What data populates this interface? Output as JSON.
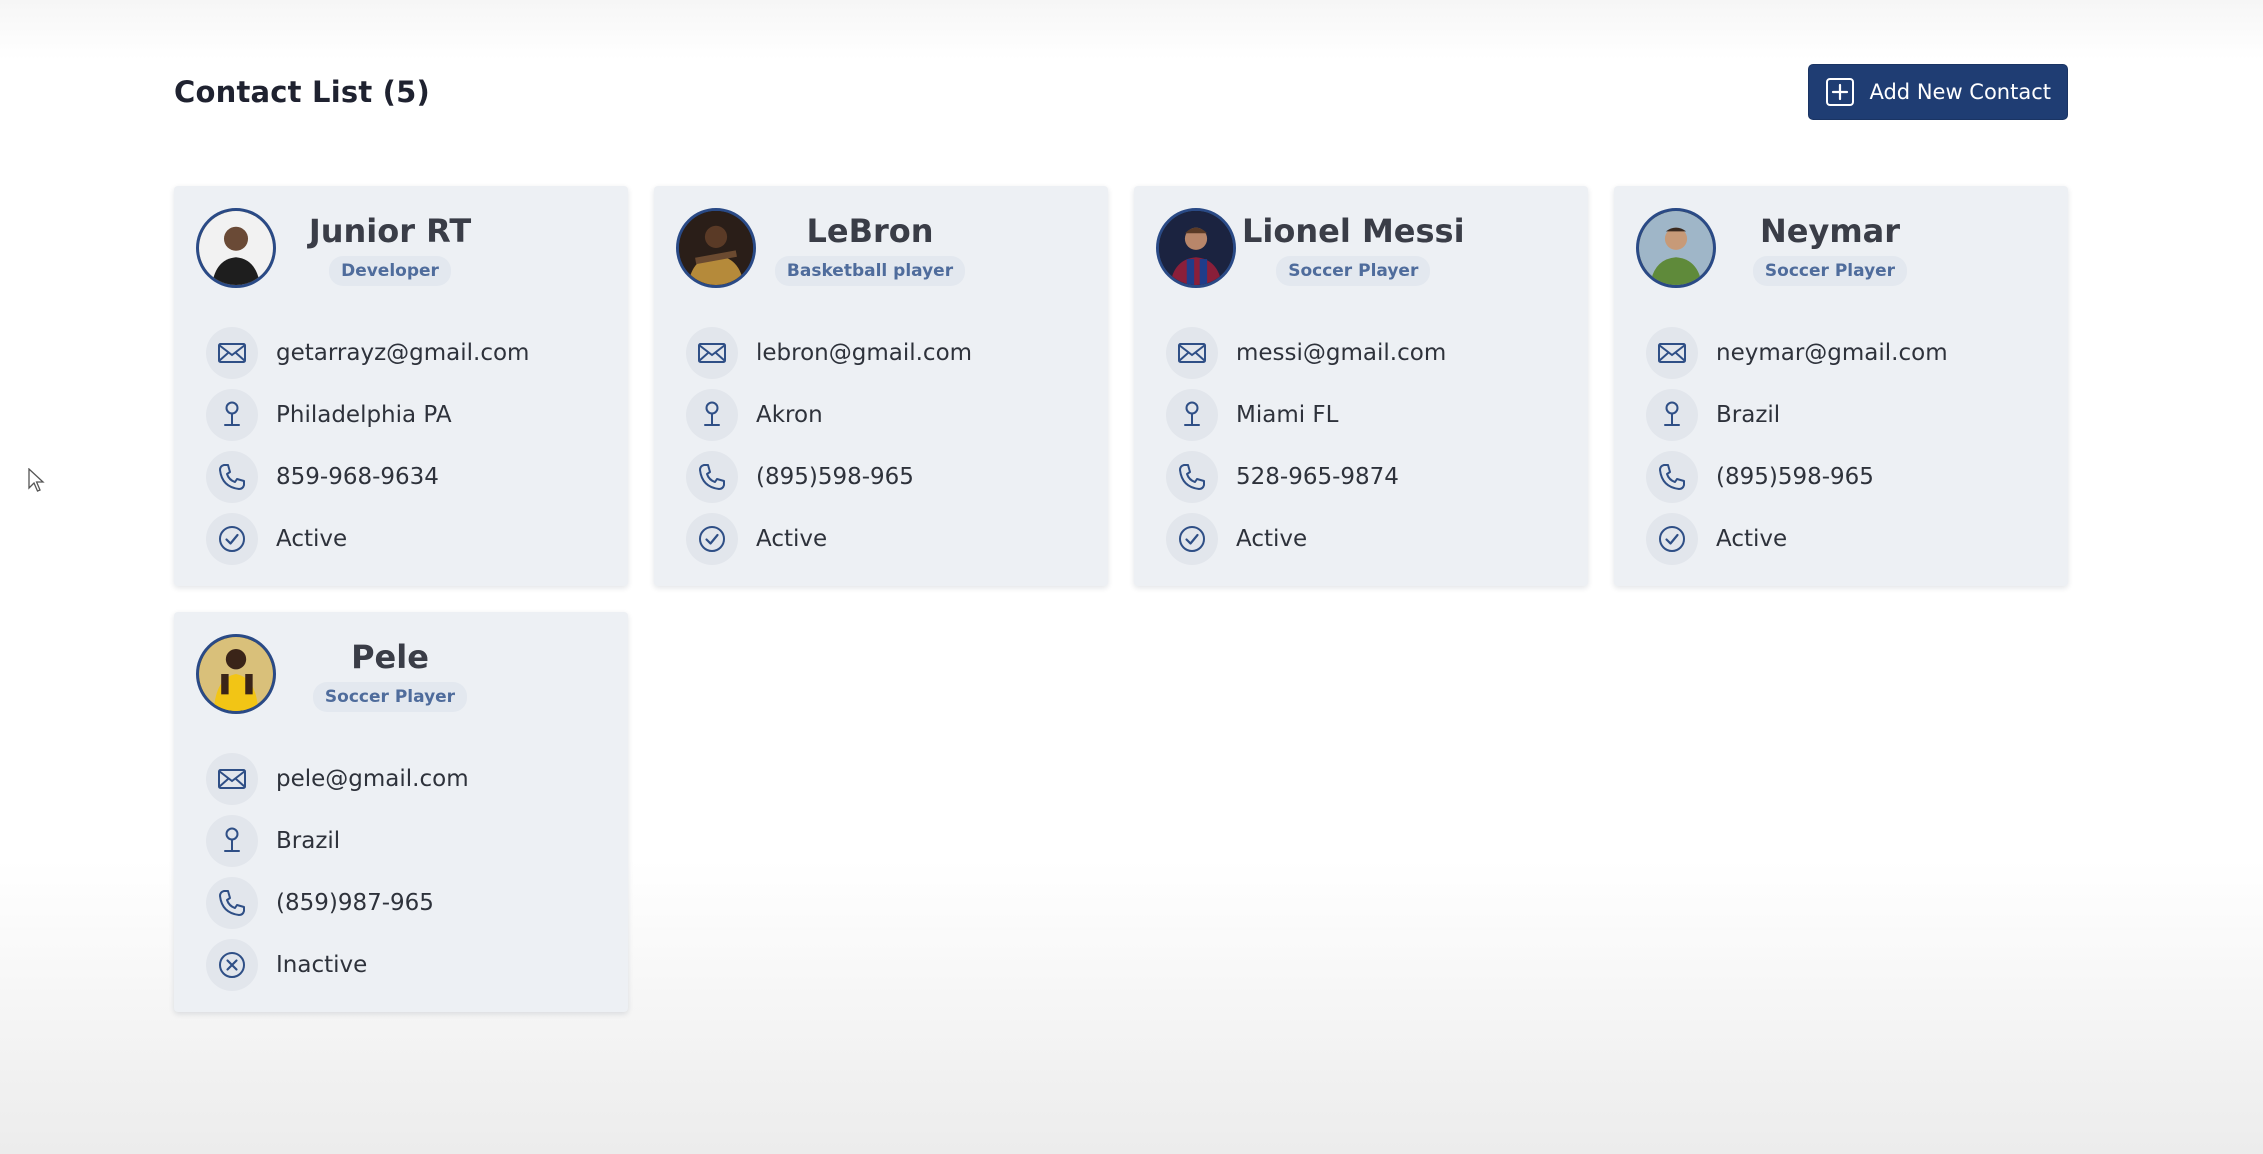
{
  "header": {
    "title": "Contact List (5)",
    "add_button_label": "Add New Contact"
  },
  "colors": {
    "primary": "#1f3d73",
    "card_bg": "#edf0f4",
    "role_text": "#4f6c9c",
    "icon": "#2f4f86"
  },
  "contacts": [
    {
      "name": "Junior RT",
      "role": "Developer",
      "email": "getarrayz@gmail.com",
      "location": "Philadelphia PA",
      "phone": "859-968-9634",
      "status": "Active"
    },
    {
      "name": "LeBron",
      "role": "Basketball player",
      "email": "lebron@gmail.com",
      "location": "Akron",
      "phone": "(895)598-965",
      "status": "Active"
    },
    {
      "name": "Lionel Messi",
      "role": "Soccer Player",
      "email": "messi@gmail.com",
      "location": "Miami FL",
      "phone": "528-965-9874",
      "status": "Active"
    },
    {
      "name": "Neymar",
      "role": "Soccer Player",
      "email": "neymar@gmail.com",
      "location": "Brazil",
      "phone": "(895)598-965",
      "status": "Active"
    },
    {
      "name": "Pele",
      "role": "Soccer Player",
      "email": "pele@gmail.com",
      "location": "Brazil",
      "phone": "(859)987-965",
      "status": "Inactive"
    }
  ]
}
